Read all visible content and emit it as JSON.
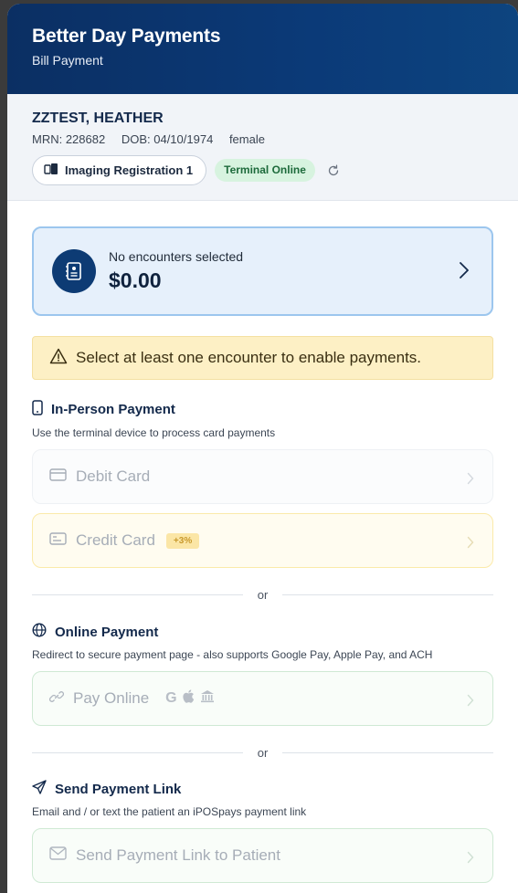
{
  "header": {
    "title": "Better Day Payments",
    "subtitle": "Bill Payment"
  },
  "patient": {
    "name": "ZZTEST, HEATHER",
    "mrn": "MRN: 228682",
    "dob": "DOB: 04/10/1974",
    "sex": "female",
    "location": "Imaging Registration 1",
    "terminal_status": "Terminal Online"
  },
  "encounter": {
    "label": "No encounters selected",
    "amount": "$0.00"
  },
  "warning": "Select at least one encounter to enable payments.",
  "in_person": {
    "title": "In-Person Payment",
    "description": "Use the terminal device to process card payments",
    "debit_label": "Debit Card",
    "credit_label": "Credit Card",
    "credit_fee": "+3%"
  },
  "divider_text": "or",
  "online": {
    "title": "Online Payment",
    "description": "Redirect to secure payment page - also supports Google Pay, Apple Pay, and ACH",
    "pay_label": "Pay Online",
    "google_letter": "G"
  },
  "link": {
    "title": "Send Payment Link",
    "description": "Email and / or text the patient an iPOSpays payment link",
    "send_label": "Send Payment Link to Patient"
  },
  "colors": {
    "header_bg": "#0b3a78",
    "online_badge_bg": "#d7f3df",
    "warning_bg": "#fdf0c5",
    "accent_navy": "#0d3b74"
  },
  "icons": {
    "location": "terminal-icon",
    "refresh": "refresh-icon",
    "encounter": "document-icon",
    "warning": "warning-triangle-icon",
    "in_person": "phone-icon",
    "debit": "card-icon",
    "credit": "credit-card-icon",
    "online": "globe-icon",
    "pay_online": "link-icon",
    "send_link": "send-icon",
    "email": "mail-icon"
  }
}
